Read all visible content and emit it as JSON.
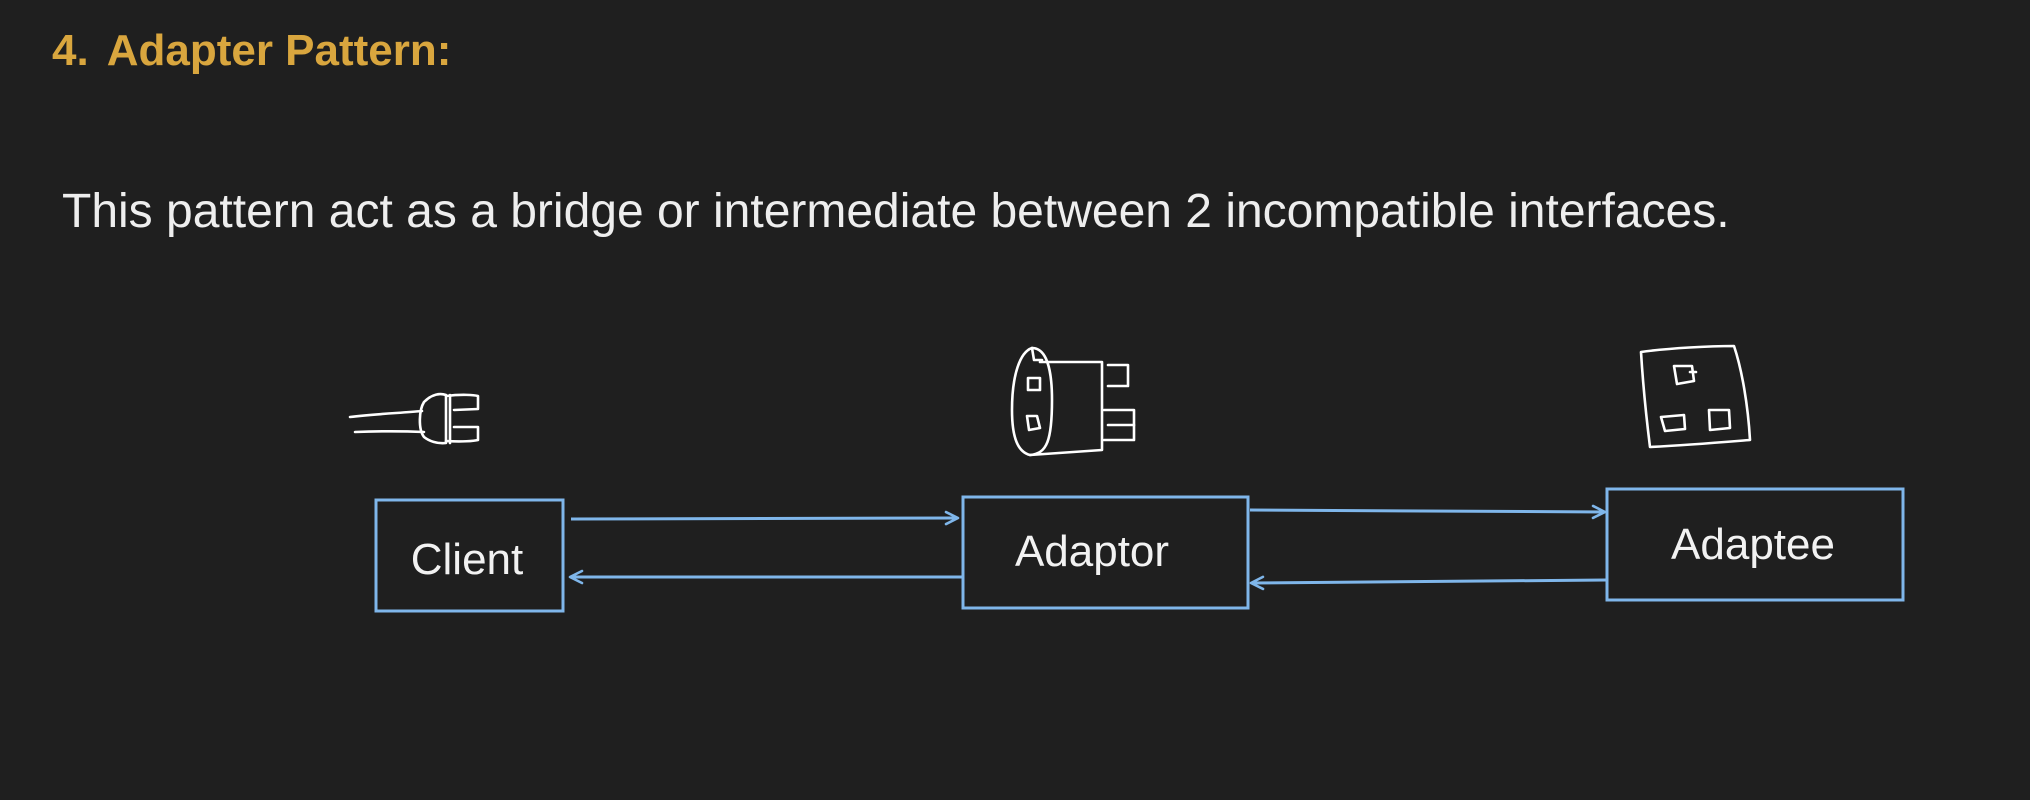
{
  "heading": {
    "number": "4.",
    "title": "Adapter Pattern:"
  },
  "description": "This pattern act as a bridge or intermediate between 2 incompatible interfaces.",
  "diagram": {
    "nodes": {
      "client": "Client",
      "adaptor": "Adaptor",
      "adaptee": "Adaptee"
    },
    "icons": {
      "client": "plug-icon",
      "adaptor": "travel-adapter-icon",
      "adaptee": "wall-socket-icon"
    },
    "colors": {
      "box_stroke": "#7fb6ea",
      "arrow": "#7fb6ea",
      "sketch": "#ffffff",
      "heading": "#d9a63e"
    }
  }
}
